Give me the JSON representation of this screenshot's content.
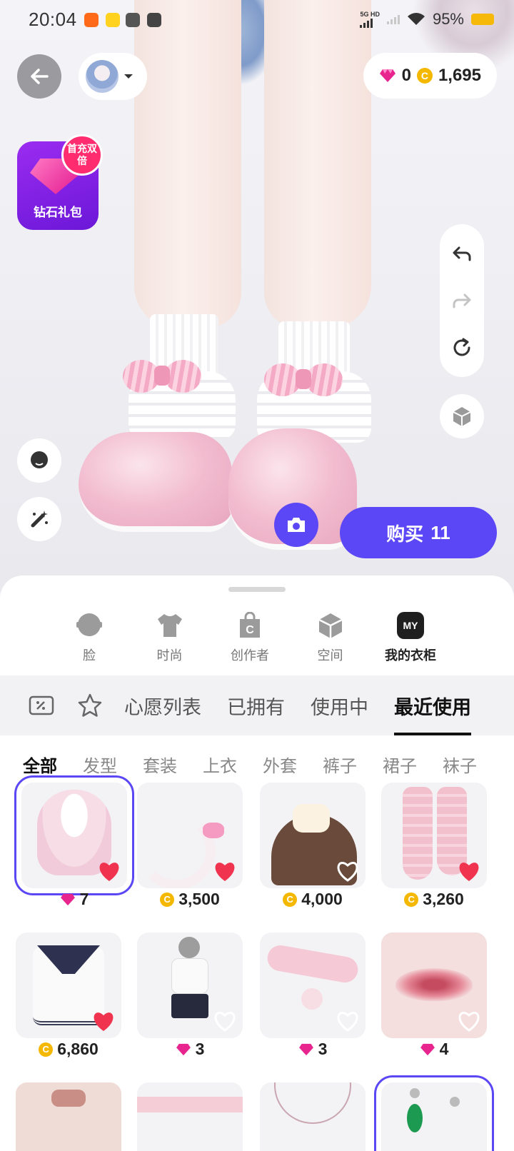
{
  "status_bar": {
    "time": "20:04",
    "network": "5G HD",
    "battery": "95%"
  },
  "top": {
    "diamonds": "0",
    "coins": "1,695"
  },
  "gift": {
    "label": "钻石礼包",
    "badge": "首充双倍"
  },
  "buy": {
    "label": "购买",
    "count": "11"
  },
  "category_tabs": [
    {
      "label": "脸",
      "icon": "face-icon"
    },
    {
      "label": "时尚",
      "icon": "tshirt-icon"
    },
    {
      "label": "创作者",
      "icon": "creator-bag-icon"
    },
    {
      "label": "空间",
      "icon": "space-cube-icon"
    },
    {
      "label": "我的衣柜",
      "icon": "my-wardrobe-icon",
      "badge": "MY"
    }
  ],
  "sub_tabs": [
    "心愿列表",
    "已拥有",
    "使用中",
    "最近使用"
  ],
  "filters": [
    "全部",
    "发型",
    "套装",
    "上衣",
    "外套",
    "裤子",
    "裙子",
    "袜子"
  ],
  "items": [
    {
      "name": "pink-twin-tail-hair",
      "currency": "diamond",
      "price": "7",
      "liked": true
    },
    {
      "name": "cat-tail-with-bow",
      "currency": "coin",
      "price": "3,500",
      "liked": true
    },
    {
      "name": "cat-hat-hair",
      "currency": "coin",
      "price": "4,000",
      "liked": false
    },
    {
      "name": "pink-leg-warmers",
      "currency": "coin",
      "price": "3,260",
      "liked": true
    },
    {
      "name": "sailor-top",
      "currency": "coin",
      "price": "6,860",
      "liked": true
    },
    {
      "name": "pose-outfit",
      "currency": "diamond",
      "price": "3",
      "liked": false
    },
    {
      "name": "pink-collar-bell",
      "currency": "diamond",
      "price": "3",
      "liked": false
    },
    {
      "name": "glossy-lips",
      "currency": "diamond",
      "price": "4",
      "liked": false
    }
  ],
  "colors": {
    "accent": "#5b47f5",
    "heart": "#f0334f",
    "coin": "#f5b800",
    "diamond": "#e8258f"
  }
}
